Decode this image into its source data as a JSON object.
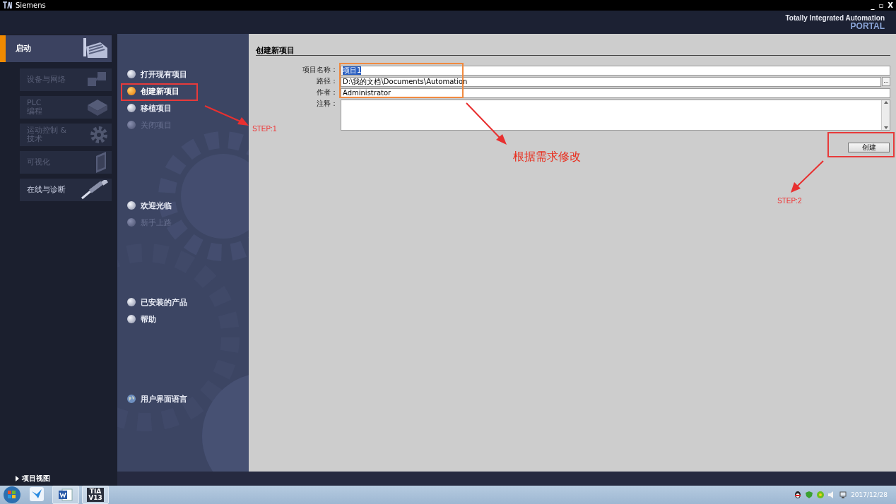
{
  "window": {
    "title": "Siemens",
    "controls": [
      "_",
      "▫",
      "X"
    ]
  },
  "header": {
    "brand": "Totally Integrated Automation",
    "product": "PORTAL"
  },
  "portal_nav": [
    {
      "label": "启动",
      "selected": true,
      "disabled": false
    },
    {
      "label": "设备与网络",
      "selected": false,
      "disabled": true
    },
    {
      "label": "PLC\n编程",
      "selected": false,
      "disabled": true
    },
    {
      "label": "运动控制 &\n技术",
      "selected": false,
      "disabled": true
    },
    {
      "label": "可视化",
      "selected": false,
      "disabled": true
    },
    {
      "label": "在线与诊断",
      "selected": false,
      "disabled": false
    }
  ],
  "action_groups": [
    [
      {
        "label": "打开现有项目",
        "kind": "action",
        "selected": false,
        "disabled": false
      },
      {
        "label": "创建新项目",
        "kind": "action",
        "selected": true,
        "disabled": false
      },
      {
        "label": "移植项目",
        "kind": "action",
        "selected": false,
        "disabled": false
      },
      {
        "label": "关闭项目",
        "kind": "action",
        "selected": false,
        "disabled": true
      }
    ],
    [
      {
        "label": "欢迎光临",
        "kind": "action",
        "selected": false,
        "disabled": false
      },
      {
        "label": "新手上路",
        "kind": "action",
        "selected": false,
        "disabled": true
      }
    ],
    [
      {
        "label": "已安装的产品",
        "kind": "action",
        "selected": false,
        "disabled": false
      },
      {
        "label": "帮助",
        "kind": "action",
        "selected": false,
        "disabled": false
      }
    ],
    [
      {
        "label": "用户界面语言",
        "kind": "language",
        "selected": false,
        "disabled": false
      }
    ]
  ],
  "create_form": {
    "heading": "创建新项目",
    "fields": [
      {
        "label": "项目名称：",
        "value": "项目1",
        "kind": "text",
        "highlighted": true
      },
      {
        "label": "路径：",
        "value": "D:\\我的文档\\Documents\\Automation",
        "kind": "path",
        "browse": "...",
        "highlighted": false
      },
      {
        "label": "作者：",
        "value": "Administrator",
        "kind": "text",
        "highlighted": false
      },
      {
        "label": "注释：",
        "kind": "textarea"
      }
    ],
    "button": "创建"
  },
  "bottom_bar": {
    "link": "项目视图"
  },
  "annotations": {
    "step1": "STEP:1",
    "step2": "STEP:2",
    "note": "根据需求修改"
  },
  "taskbar": {
    "apps": [
      {
        "kind": "bird"
      },
      {
        "kind": "word"
      },
      {
        "kind": "tia",
        "label": "TIA\nV13"
      }
    ],
    "date": "2017/12/28"
  }
}
